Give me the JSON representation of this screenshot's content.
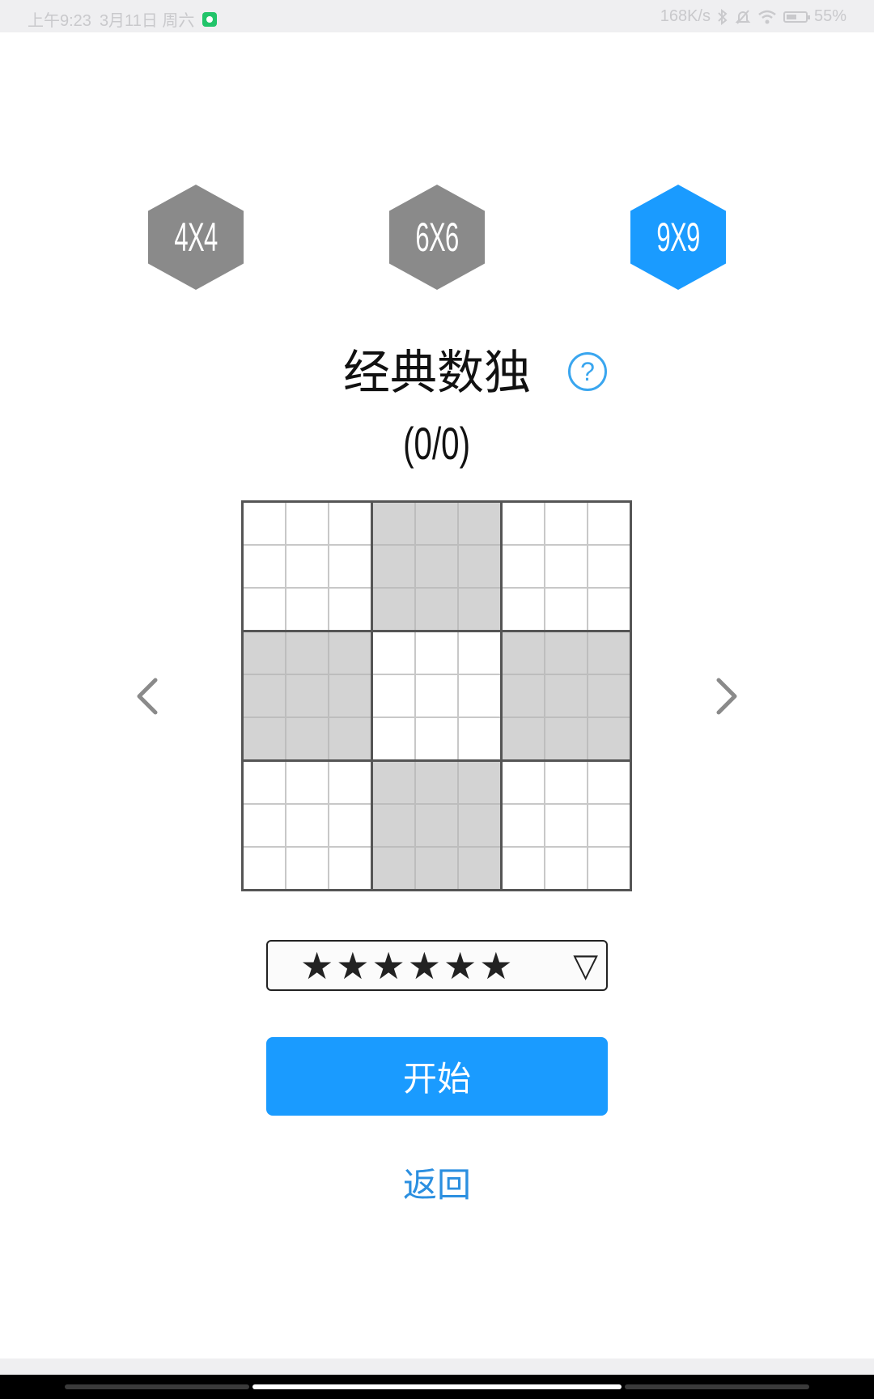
{
  "status_bar": {
    "time": "上午9:23",
    "date": "3月11日 周六",
    "net_speed": "168K/s",
    "battery": "55%",
    "battery_level": 0.55
  },
  "sizes": [
    {
      "label": "4X4",
      "selected": false
    },
    {
      "label": "6X6",
      "selected": false
    },
    {
      "label": "9X9",
      "selected": true
    }
  ],
  "title": "经典数独",
  "help_symbol": "?",
  "progress": "(0/0)",
  "board": {
    "size": 9,
    "box_shading": [
      [
        "white",
        "shade",
        "white"
      ],
      [
        "shade",
        "white",
        "shade"
      ],
      [
        "white",
        "shade",
        "white"
      ]
    ]
  },
  "difficulty": {
    "stars": "★★★★★★",
    "caret": "▽"
  },
  "start_label": "开始",
  "back_label": "返回",
  "colors": {
    "accent": "#1a9bff",
    "hex_inactive": "#8a8a8a",
    "link": "#2b8fe0"
  }
}
